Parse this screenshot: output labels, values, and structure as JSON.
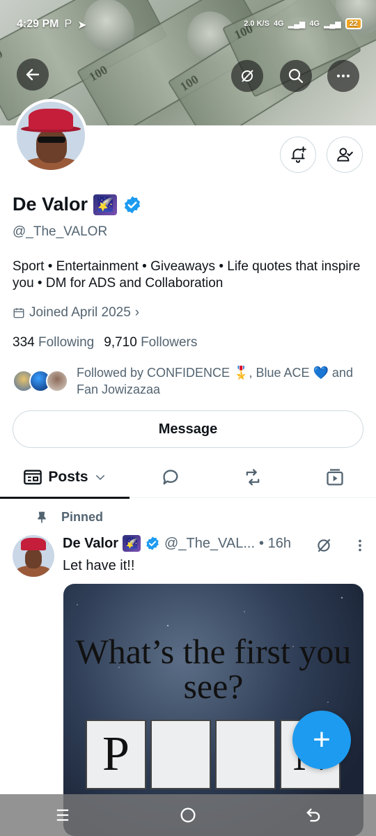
{
  "status_bar": {
    "time": "4:29 PM",
    "indicators": [
      "P",
      "send-icon",
      "a-icon"
    ],
    "net_speed": "2.0 K/S",
    "network_1": "4G",
    "network_2": "4G",
    "battery": "22"
  },
  "header": {
    "back_icon": "arrow-left-icon",
    "grok_icon": "grok-icon",
    "search_icon": "search-icon",
    "more_icon": "more-horizontal-icon"
  },
  "profile": {
    "name": "De Valor",
    "name_emoji": "🌠",
    "handle": "@_The_VALOR",
    "bio": "Sport • Entertainment • Giveaways • Life quotes that inspire you • DM for ADS and Collaboration",
    "joined": "Joined April 2025",
    "following_count": "334",
    "following_label": "Following",
    "followers_count": "9,710",
    "followers_label": "Followers",
    "followed_by": "Followed by CONFIDENCE 🎖️, Blue ACE 💙 and Fan Jowizazaa"
  },
  "actions": {
    "message_label": "Message"
  },
  "tabs": {
    "posts_label": "Posts",
    "replies_icon": "reply-icon",
    "reposts_icon": "repost-icon",
    "media_icon": "media-icon"
  },
  "post": {
    "pinned_label": "Pinned",
    "author_name": "De Valor",
    "author_emoji": "🌠",
    "author_handle": "@_The_VAL...",
    "time": "• 16h",
    "text": "Let have it!!",
    "image": {
      "title": "What’s the first you see?",
      "tiles": [
        "P",
        "",
        "",
        "N"
      ]
    }
  },
  "fab": {
    "label": "+"
  },
  "colors": {
    "accent": "#1d9bf0",
    "text": "#0f1419",
    "secondary": "#536471"
  }
}
